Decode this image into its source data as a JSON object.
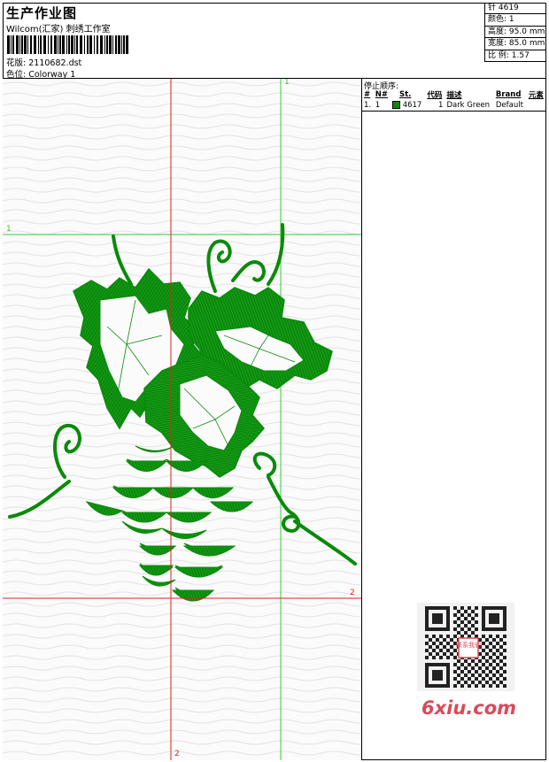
{
  "header": {
    "title": "生产作业图",
    "subtitle": "Wilcom(汇家) 刺绣工作室",
    "design_label": "花版:",
    "design_value": "2110682.dst",
    "colorway_label": "色位:",
    "colorway_value": "Colorway 1"
  },
  "stats": [
    {
      "label": "针 ",
      "value": "4619"
    },
    {
      "label": "颜色:",
      "value": "1"
    },
    {
      "label": "高度:",
      "value": "95.0 mm"
    },
    {
      "label": "宽度:",
      "value": "85.0 mm"
    },
    {
      "label": "比 例:",
      "value": "1.57"
    }
  ],
  "stop_sequence": {
    "title": "停止顺序:",
    "headers": {
      "num": "#",
      "n": "N#",
      "st": "St.",
      "code": "代码",
      "desc": "描述",
      "brand": "Brand",
      "elem": "元素"
    },
    "rows": [
      {
        "num": "1.",
        "n": "1",
        "st": "4617",
        "code": "1",
        "desc": "Dark Green",
        "brand": "Default",
        "color": "#0a8a0a"
      }
    ]
  },
  "canvas": {
    "guide_label_1_top": "1",
    "guide_label_1_left": "1",
    "guide_label_2_right": "2",
    "guide_label_2_bottom": "2",
    "guide_green": "#33cc33",
    "guide_red": "#dd2222",
    "stitch_color": "#0a8a0a"
  },
  "watermark": {
    "text": "6xiu.com",
    "qr_stamp": "联系我们"
  }
}
